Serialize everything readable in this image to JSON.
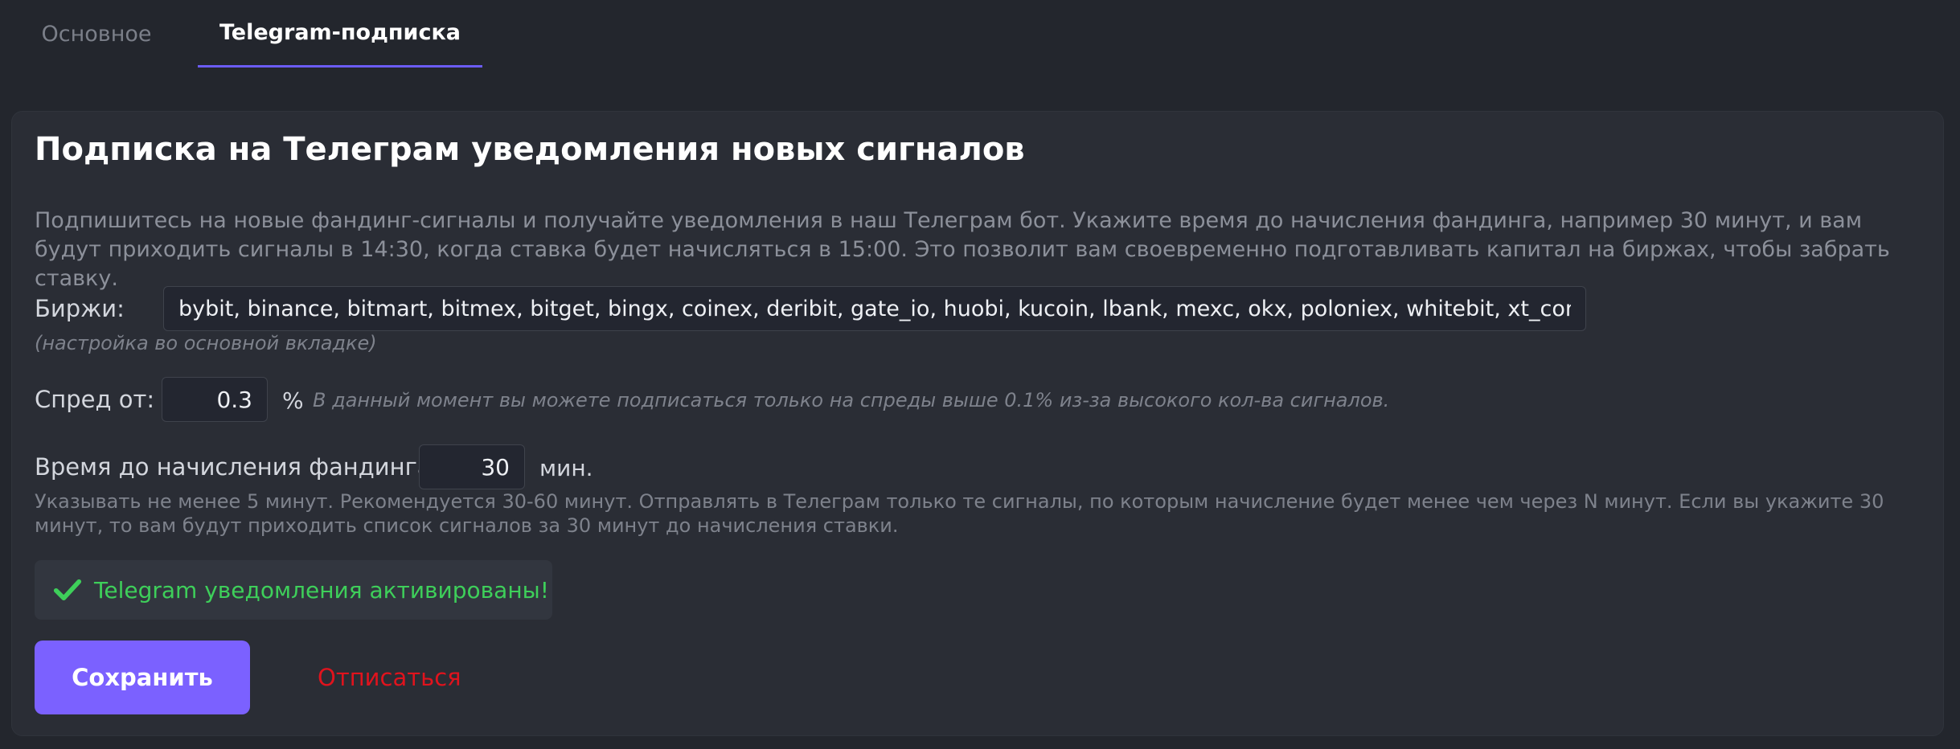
{
  "tabs": [
    {
      "label": "Основное",
      "active": false
    },
    {
      "label": "Telegram-подписка",
      "active": true
    }
  ],
  "card": {
    "title": "Подписка на Телеграм уведомления новых сигналов",
    "description": "Подпишитесь на новые фандинг-сигналы и получайте уведомления в наш Телеграм бот. Укажите время до начисления фандинга, например 30 минут, и вам будут приходить сигналы в 14:30, когда ставка будет начисляться в 15:00. Это позволит вам своевременно подготавливать капитал на биржах, чтобы забрать ставку."
  },
  "exchanges": {
    "label": "Биржи:",
    "value": "bybit, binance, bitmart, bitmex, bitget, bingx, coinex, deribit, gate_io, huobi, kucoin, lbank, mexc, okx, poloniex, whitebit, xt_com",
    "hint": "(настройка во основной вкладке)"
  },
  "spread": {
    "label": "Спред от:",
    "value": "0.3",
    "unit": "%",
    "hint": "В данный момент вы можете подписаться только на спреды выше 0.1% из-за высокого кол-ва сигналов."
  },
  "funding": {
    "label": "Время до начисления фандинга:",
    "value": "30",
    "unit": "мин.",
    "hint": "Указывать не менее 5 минут. Рекомендуется 30-60 минут. Отправлять в Телеграм только те сигналы, по которым начисление будет менее чем через N минут. Если вы укажите 30 минут, то вам будут приходить список сигналов за 30 минут до начисления ставки."
  },
  "status": {
    "icon": "check-icon",
    "text": "Telegram уведомления активированы!",
    "color": "#3ecf5a"
  },
  "actions": {
    "save_label": "Сохранить",
    "unsubscribe_label": "Отписаться"
  },
  "colors": {
    "accent": "#7b61ff",
    "danger": "#e0131d",
    "tab_underline": "#6b5cf6"
  }
}
